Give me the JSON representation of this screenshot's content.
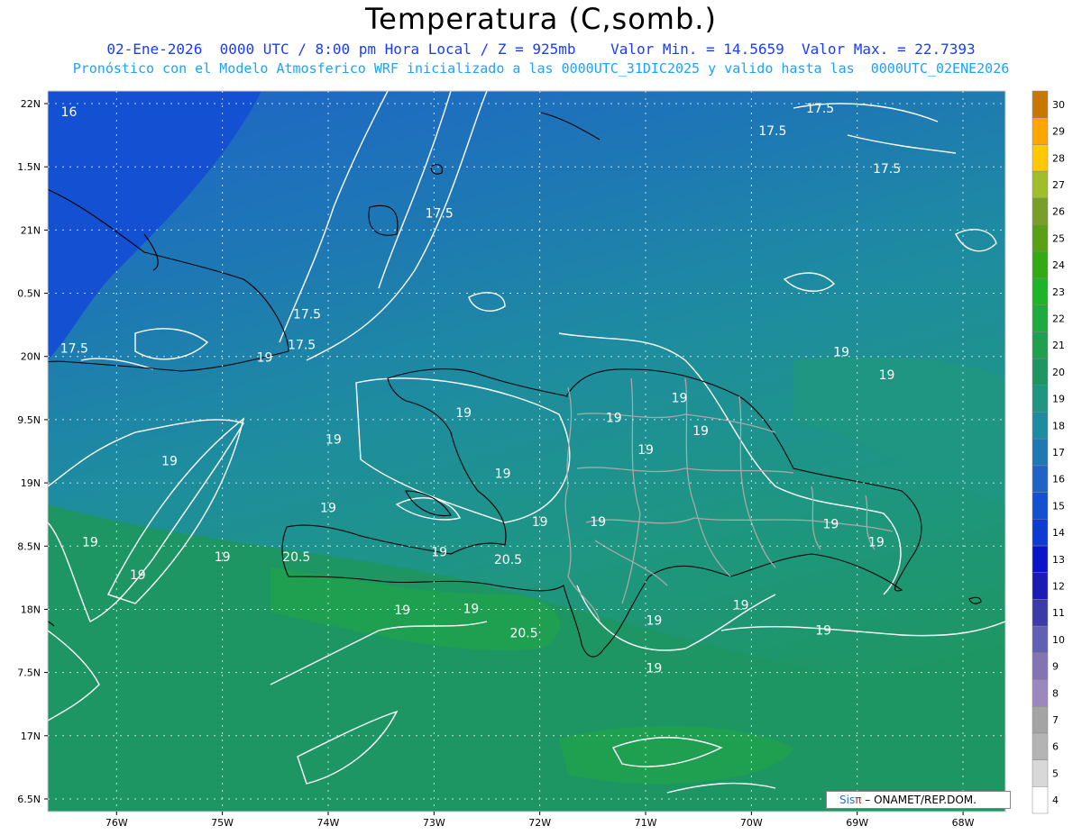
{
  "title": "Temperatura (C,somb.)",
  "subtitle_line1": "02-Ene-2026  0000 UTC / 8:00 pm Hora Local / Z = 925mb    Valor Min. = 14.5659  Valor Max. = 22.7393",
  "subtitle_line2": "Pronóstico con el Modelo Atmosferico WRF inicializado a las 0000UTC_31DIC2025 y valido hasta las  0000UTC_02ENE2026",
  "credit": {
    "brand": "Sis",
    "pi": "π",
    "text": "– ONAMET/REP.DOM."
  },
  "chart_data": {
    "type": "heatmap",
    "variable": "Temperatura (C,somb.)",
    "valid_time": "02-Ene-2026 0000 UTC / 8:00 pm Hora Local",
    "level": "Z = 925mb",
    "value_min": 14.5659,
    "value_max": 22.7393,
    "xlim": [
      -76.65,
      -67.6
    ],
    "ylim": [
      16.4,
      22.1
    ],
    "x_ticks": [
      "76W",
      "75W",
      "74W",
      "73W",
      "72W",
      "71W",
      "70W",
      "69W",
      "68W"
    ],
    "y_ticks": [
      "22N",
      "1.5N",
      "21N",
      "0.5N",
      "20N",
      "9.5N",
      "19N",
      "8.5N",
      "18N",
      "7.5N",
      "17N",
      "6.5N"
    ],
    "grid": true,
    "colorbar": {
      "levels": [
        4,
        5,
        6,
        7,
        8,
        9,
        10,
        11,
        12,
        13,
        14,
        15,
        16,
        17,
        18,
        19,
        20,
        21,
        22,
        23,
        24,
        25,
        26,
        27,
        28,
        29,
        30
      ],
      "colors": [
        "#ffffff",
        "#d8d8d8",
        "#b4b4b4",
        "#a4a4a4",
        "#9c88c0",
        "#8474b4",
        "#6060b4",
        "#3c3ca8",
        "#1c1cb4",
        "#0a14c8",
        "#0c3cd2",
        "#1450d2",
        "#1e64c8",
        "#1e78b4",
        "#1e8ca0",
        "#1e9682",
        "#1e9664",
        "#1ea050",
        "#1eaa3c",
        "#1eb428",
        "#32aa14",
        "#5aa014",
        "#78a028",
        "#a0be28",
        "#ffc800",
        "#ffa500",
        "#c87800"
      ]
    },
    "contour_labels": [
      {
        "value": "16",
        "lon": -76.45,
        "lat": 21.9
      },
      {
        "value": "17.5",
        "lon": -69.35,
        "lat": 21.93
      },
      {
        "value": "17.5",
        "lon": -69.8,
        "lat": 21.75
      },
      {
        "value": "17.5",
        "lon": -68.72,
        "lat": 21.45
      },
      {
        "value": "17.5",
        "lon": -72.95,
        "lat": 21.1
      },
      {
        "value": "17.5",
        "lon": -74.2,
        "lat": 20.3
      },
      {
        "value": "17.5",
        "lon": -74.25,
        "lat": 20.06
      },
      {
        "value": "17.5",
        "lon": -76.4,
        "lat": 20.03
      },
      {
        "value": "19",
        "lon": -74.6,
        "lat": 19.96
      },
      {
        "value": "19",
        "lon": -69.15,
        "lat": 20.0
      },
      {
        "value": "19",
        "lon": -68.72,
        "lat": 19.82
      },
      {
        "value": "19",
        "lon": -70.68,
        "lat": 19.64
      },
      {
        "value": "19",
        "lon": -72.72,
        "lat": 19.52
      },
      {
        "value": "19",
        "lon": -71.3,
        "lat": 19.48
      },
      {
        "value": "19",
        "lon": -70.48,
        "lat": 19.38
      },
      {
        "value": "19",
        "lon": -73.95,
        "lat": 19.31
      },
      {
        "value": "19",
        "lon": -71.0,
        "lat": 19.23
      },
      {
        "value": "19",
        "lon": -75.5,
        "lat": 19.14
      },
      {
        "value": "19",
        "lon": -72.35,
        "lat": 19.04
      },
      {
        "value": "19",
        "lon": -74.0,
        "lat": 18.77
      },
      {
        "value": "19",
        "lon": -72.0,
        "lat": 18.66
      },
      {
        "value": "19",
        "lon": -71.45,
        "lat": 18.66
      },
      {
        "value": "19",
        "lon": -69.25,
        "lat": 18.64
      },
      {
        "value": "19",
        "lon": -68.82,
        "lat": 18.5
      },
      {
        "value": "19",
        "lon": -76.25,
        "lat": 18.5
      },
      {
        "value": "19",
        "lon": -75.0,
        "lat": 18.38
      },
      {
        "value": "19",
        "lon": -75.8,
        "lat": 18.24
      },
      {
        "value": "19",
        "lon": -72.95,
        "lat": 18.42
      },
      {
        "value": "19",
        "lon": -70.1,
        "lat": 18.0
      },
      {
        "value": "19",
        "lon": -73.3,
        "lat": 17.96
      },
      {
        "value": "19",
        "lon": -72.65,
        "lat": 17.97
      },
      {
        "value": "19",
        "lon": -70.92,
        "lat": 17.88
      },
      {
        "value": "19",
        "lon": -69.32,
        "lat": 17.8
      },
      {
        "value": "19",
        "lon": -70.92,
        "lat": 17.5
      },
      {
        "value": "20.5",
        "lon": -74.3,
        "lat": 18.38
      },
      {
        "value": "20.5",
        "lon": -72.3,
        "lat": 18.36
      },
      {
        "value": "20.5",
        "lon": -72.15,
        "lat": 17.78
      }
    ]
  }
}
